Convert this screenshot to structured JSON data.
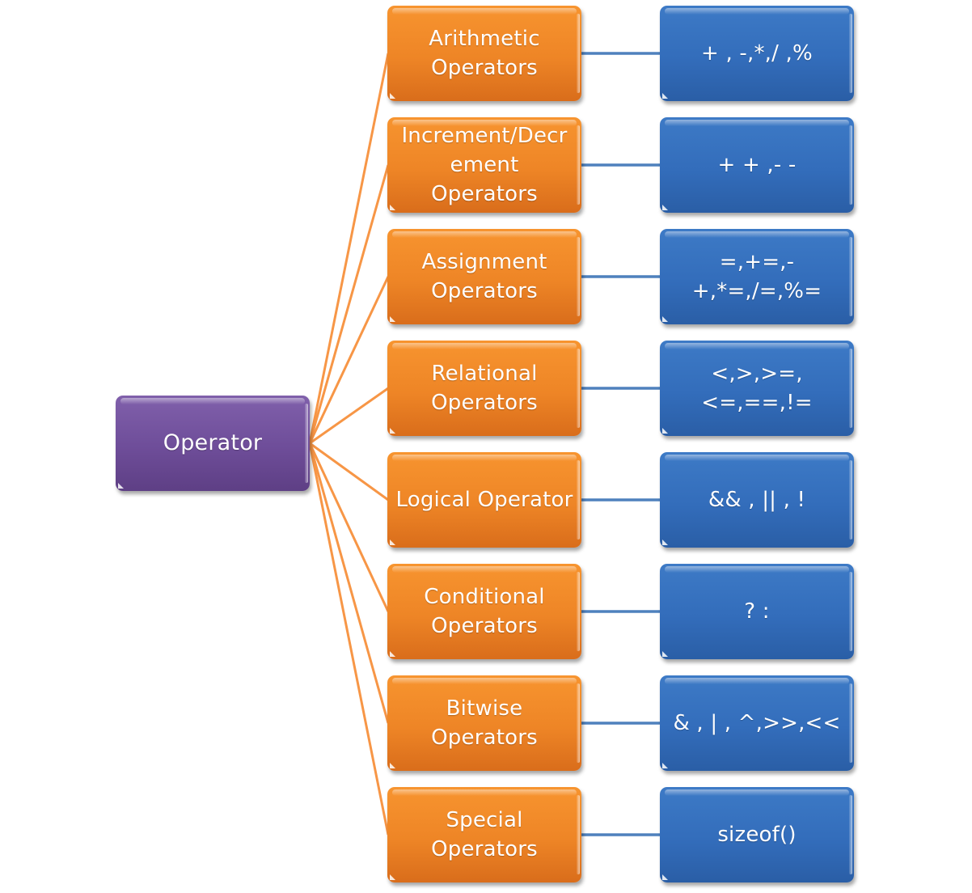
{
  "diagram": {
    "root": {
      "label": "Operator",
      "color": "#7456a0"
    },
    "category_color": "#f08a2a",
    "example_color": "#3470bd",
    "branch_line_color": "#f79646",
    "link_line_color": "#4f81bd",
    "categories": [
      {
        "label": "Arithmetic\nOperators",
        "examples": "+ , -,*,/ ,%"
      },
      {
        "label": "Increment/Decr\nement\nOperators",
        "examples": "+ + ,- -"
      },
      {
        "label": "Assignment\nOperators",
        "examples": "=,+=,-+,*=,/=,%="
      },
      {
        "label": "Relational\nOperators",
        "examples": "<,>,>=,<=,==,!="
      },
      {
        "label": "Logical Operator",
        "examples": "&& , || , !"
      },
      {
        "label": "Conditional\nOperators",
        "examples": "? :"
      },
      {
        "label": "Bitwise\nOperators",
        "examples": "& , | , ^,>>,<<"
      },
      {
        "label": "Special\nOperators",
        "examples": "sizeof()"
      }
    ]
  }
}
